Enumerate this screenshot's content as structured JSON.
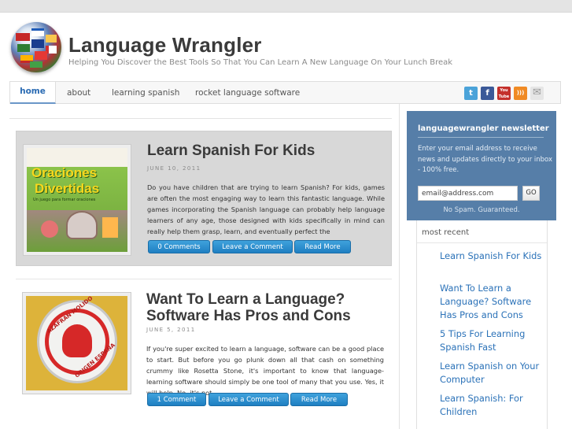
{
  "header": {
    "title": "Language Wrangler",
    "tagline": "Helping You Discover the Best Tools So That You Can Learn A New Language On Your Lunch Break"
  },
  "nav": {
    "items": [
      "home",
      "about",
      "learning spanish",
      "rocket language software"
    ],
    "social": [
      {
        "name": "twitter",
        "glyph": "t",
        "color": "#4ba3d9"
      },
      {
        "name": "facebook",
        "glyph": "f",
        "color": "#3b5998"
      },
      {
        "name": "youtube",
        "glyph": "You Tube",
        "color": "#c4302b"
      },
      {
        "name": "rss",
        "glyph": ")))",
        "color": "#f08a24"
      },
      {
        "name": "email",
        "glyph": "✉",
        "color": "#bbbbbb"
      }
    ]
  },
  "posts": [
    {
      "title": "Learn Spanish For Kids",
      "date": "JUNE 10, 2011",
      "excerpt": "Do you have children that are trying to learn Spanish? For kids, games are often the most engaging way to learn this fantastic language. While games incorporating the Spanish language can probably help language learners of any age, those designed with kids specifically in mind can really help them grasp, learn, and eventually perfect the",
      "thumb_text_1": "Oraciones",
      "thumb_text_2": "Divertidas",
      "thumb_text_3": "Un juego para formar oraciones",
      "comments_label": "0 Comments",
      "leave_label": "Leave a Comment",
      "more_label": "Read More"
    },
    {
      "title": "Want To Learn a Language? Software Has Pros and Cons",
      "date": "JUNE 5, 2011",
      "excerpt": "If you're super excited to learn a language, software can be a good place to start. But before you go plunk down all that cash on something crummy like Rosetta Stone, it's important to know that language-learning software should simply be one tool of many that you use. Yes, it will help. No, it's not",
      "thumb_text_1": "AZAFRAN MOLIDO",
      "thumb_text_2": "ORIGEN ESPAÑA",
      "comments_label": "1 Comment",
      "leave_label": "Leave a Comment",
      "more_label": "Read More"
    }
  ],
  "sidebar": {
    "newsletter": {
      "title": "languagewrangler newsletter",
      "text": "Enter your email address to receive news and updates directly to your inbox - 100% free.",
      "email_value": "email@address.com",
      "go_label": "GO",
      "spam_note": "No Spam. Guaranteed."
    },
    "recent": {
      "title": "most recent",
      "links": [
        "Learn Spanish For Kids",
        "Want To Learn a Language? Software Has Pros and Cons",
        "5 Tips For Learning Spanish Fast",
        "Learn Spanish on Your Computer",
        "Learn Spanish: For Children"
      ]
    }
  },
  "colors": {
    "accent": "#2b72b8",
    "button": "#1f7fc2",
    "newsletter_bg": "#567ea8"
  }
}
